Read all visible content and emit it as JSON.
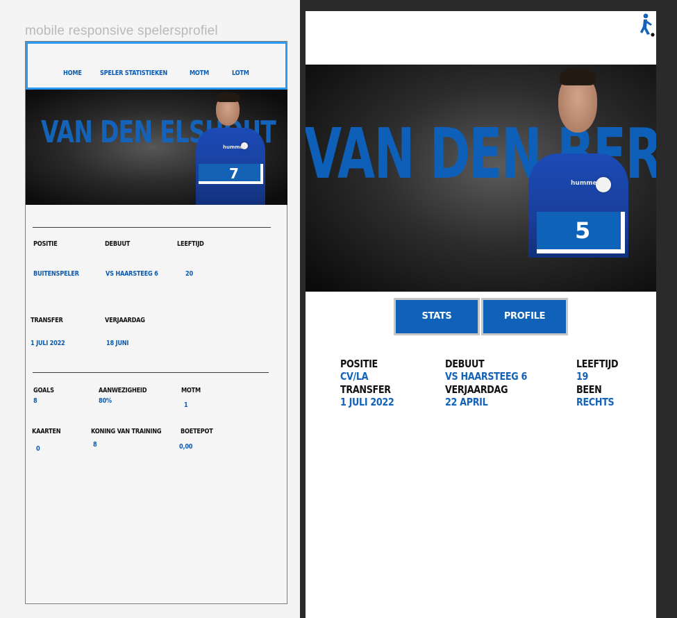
{
  "left": {
    "title": "mobile responsive spelersprofiel",
    "nav": [
      "HOME",
      "SPELER STATISTIEKEN",
      "MOTM",
      "LOTM"
    ],
    "hero_name": "VAN DEN ELSHOUT",
    "number": "7",
    "info1": {
      "labels": [
        "POSITIE",
        "DEBUUT",
        "LEEFTIJD"
      ],
      "values": [
        "BUITENSPELER",
        "VS HAARSTEEG 6",
        "20"
      ]
    },
    "info2": {
      "labels": [
        "TRANSFER",
        "VERJAARDAG"
      ],
      "values": [
        "1 JULI 2022",
        "18 JUNI"
      ]
    },
    "stats1": {
      "labels": [
        "GOALS",
        "AANWEZIGHEID",
        "MOTM"
      ],
      "values": [
        "8",
        "80%",
        "1"
      ]
    },
    "stats2": {
      "labels": [
        "KAARTEN",
        "KONING VAN TRAINING",
        "BOETEPOT"
      ],
      "values": [
        "0",
        "8",
        "0,00"
      ]
    },
    "brand": "hummel"
  },
  "right": {
    "hero_name": "VAN DEN BERK",
    "number": "5",
    "buttons": [
      "STATS",
      "PROFILE"
    ],
    "row1_labels": [
      "POSITIE",
      "DEBUUT",
      "LEEFTIJD"
    ],
    "row1_values": [
      "CV/LA",
      "VS HAARSTEEG 6",
      "19"
    ],
    "row2_labels": [
      "TRANSFER",
      "VERJAARDAG",
      "BEEN"
    ],
    "row2_values": [
      "1 JULI 2022",
      "22 APRIL",
      "RECHTS"
    ],
    "brand": "hummel",
    "logo_icon": "running-person-logo-icon"
  },
  "colors": {
    "accent_blue": "#1463b8",
    "nav_border": "#2b9af3",
    "dark": "#2a2a2a"
  }
}
